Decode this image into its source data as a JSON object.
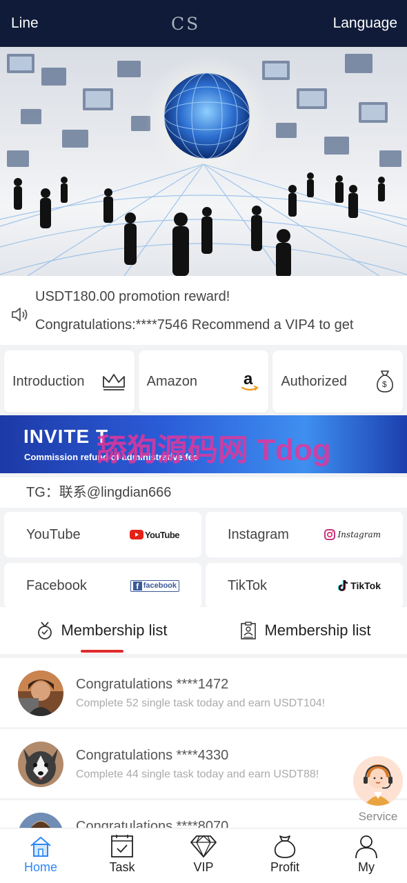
{
  "header": {
    "left_label": "Line",
    "logo": "CS",
    "right_label": "Language"
  },
  "notice": {
    "lines": [
      "USDT180.00 promotion reward!",
      "Congratulations:****7546 Recommend a VIP4 to get"
    ],
    "icon": "speaker-icon"
  },
  "links": [
    {
      "label": "Introduction",
      "icon": "crown-icon"
    },
    {
      "label": "Amazon",
      "icon": "amazon-icon"
    },
    {
      "label": "Authorized",
      "icon": "money-bag-icon"
    }
  ],
  "invite_banner": {
    "title": "INVITE T",
    "subtitle": "Commission refund of administrative fee",
    "watermark": "舔狗源码网 Tdog"
  },
  "tg": {
    "text": "TG：联系@lingdian666"
  },
  "social": [
    {
      "label": "YouTube",
      "logo": "YouTube"
    },
    {
      "label": "Instagram",
      "logo": "Instagram"
    },
    {
      "label": "Facebook",
      "logo": "facebook"
    },
    {
      "label": "TikTok",
      "logo": "TikTok"
    }
  ],
  "tabs": [
    {
      "label": "Membership list",
      "icon": "medal-icon",
      "active": true
    },
    {
      "label": "Membership list",
      "icon": "clipboard-icon",
      "active": false
    }
  ],
  "members": [
    {
      "title": "Congratulations ****1472",
      "desc": "Complete 52 single task today and earn USDT104!"
    },
    {
      "title": "Congratulations ****4330",
      "desc": "Complete 44 single task today and earn USDT88!"
    },
    {
      "title": "Congratulations ****8070",
      "desc": ""
    }
  ],
  "service": {
    "label": "Service"
  },
  "nav": [
    {
      "label": "Home",
      "icon": "home-icon",
      "active": true
    },
    {
      "label": "Task",
      "icon": "task-icon",
      "active": false
    },
    {
      "label": "VIP",
      "icon": "diamond-icon",
      "active": false
    },
    {
      "label": "Profit",
      "icon": "money-bag-icon",
      "active": false
    },
    {
      "label": "My",
      "icon": "user-icon",
      "active": false
    }
  ],
  "colors": {
    "header_bg": "#0f1b38",
    "active": "#2a87f5",
    "tab_underline": "#e02b2b"
  }
}
